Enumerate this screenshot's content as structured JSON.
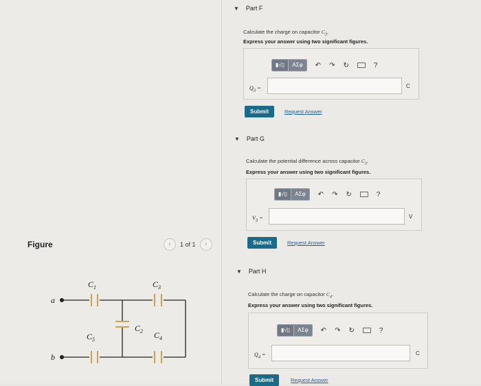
{
  "figure_panel": {
    "title": "Figure",
    "pager": {
      "text": "1 of 1",
      "prev_icon": "chevron-left",
      "next_icon": "chevron-right"
    },
    "circuit": {
      "terminal_a": "a",
      "terminal_b": "b",
      "caps": {
        "c1": "C",
        "c1_sub": "1",
        "c2": "C",
        "c2_sub": "2",
        "c3": "C",
        "c3_sub": "3",
        "c4": "C",
        "c4_sub": "4",
        "c5": "C",
        "c5_sub": "5"
      }
    }
  },
  "toolbar": {
    "sqrt_label": "▮√▯",
    "greek_label": "ΑΣφ",
    "undo_icon": "undo",
    "redo_icon": "redo",
    "reset_icon": "reset",
    "keyboard_icon": "keyboard",
    "help_label": "?"
  },
  "parts": {
    "f": {
      "title": "Part F",
      "question_prefix": "Calculate the charge on capacitor ",
      "question_var": "C",
      "question_sub": "3",
      "question_suffix": ".",
      "instruction": "Express your answer using two significant figures.",
      "answer_var": "Q",
      "answer_sub": "3",
      "equals": "=",
      "input_value": "",
      "unit": "C",
      "submit": "Submit",
      "request": "Request Answer"
    },
    "g": {
      "title": "Part G",
      "question_prefix": "Calculate the potential difference across capacitor ",
      "question_var": "C",
      "question_sub": "3",
      "question_suffix": ".",
      "instruction": "Express your answer using two significant figures.",
      "answer_var": "V",
      "answer_sub": "3",
      "equals": "=",
      "input_value": "",
      "unit": "V",
      "submit": "Submit",
      "request": "Request Answer"
    },
    "h": {
      "title": "Part H",
      "question_prefix": "Calculate the charge on capacitor ",
      "question_var": "C",
      "question_sub": "4",
      "question_suffix": ".",
      "instruction": "Express your answer using two significant figures.",
      "answer_var": "Q",
      "answer_sub": "4",
      "equals": "=",
      "input_value": "",
      "unit": "C",
      "submit": "Submit",
      "request": "Request Answer"
    }
  }
}
